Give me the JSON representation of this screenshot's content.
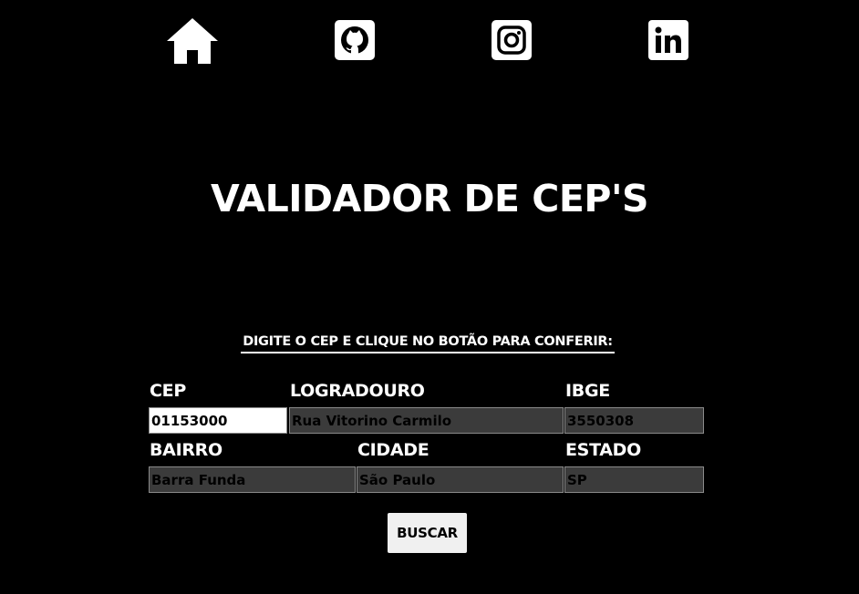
{
  "nav": {
    "items": [
      {
        "icon": "home-icon"
      },
      {
        "icon": "github-icon"
      },
      {
        "icon": "instagram-icon"
      },
      {
        "icon": "linkedin-icon"
      }
    ]
  },
  "title": "VALIDADOR DE CEP'S",
  "instruction": "DIGITE O CEP E CLIQUE NO BOTÃO PARA CONFERIR:",
  "form": {
    "cep": {
      "label": "CEP",
      "value": "01153000"
    },
    "logradouro": {
      "label": "LOGRADOURO",
      "value": "Rua Vitorino Carmilo"
    },
    "ibge": {
      "label": "IBGE",
      "value": "3550308"
    },
    "bairro": {
      "label": "BAIRRO",
      "value": "Barra Funda"
    },
    "cidade": {
      "label": "CIDADE",
      "value": "São Paulo"
    },
    "estado": {
      "label": "ESTADO",
      "value": "SP"
    }
  },
  "button": {
    "label": "BUSCAR"
  },
  "colors": {
    "background": "#000000",
    "text": "#ffffff",
    "input_readonly": "#3b3b3b",
    "input_active": "#ffffff",
    "button": "#f0f0f0"
  }
}
